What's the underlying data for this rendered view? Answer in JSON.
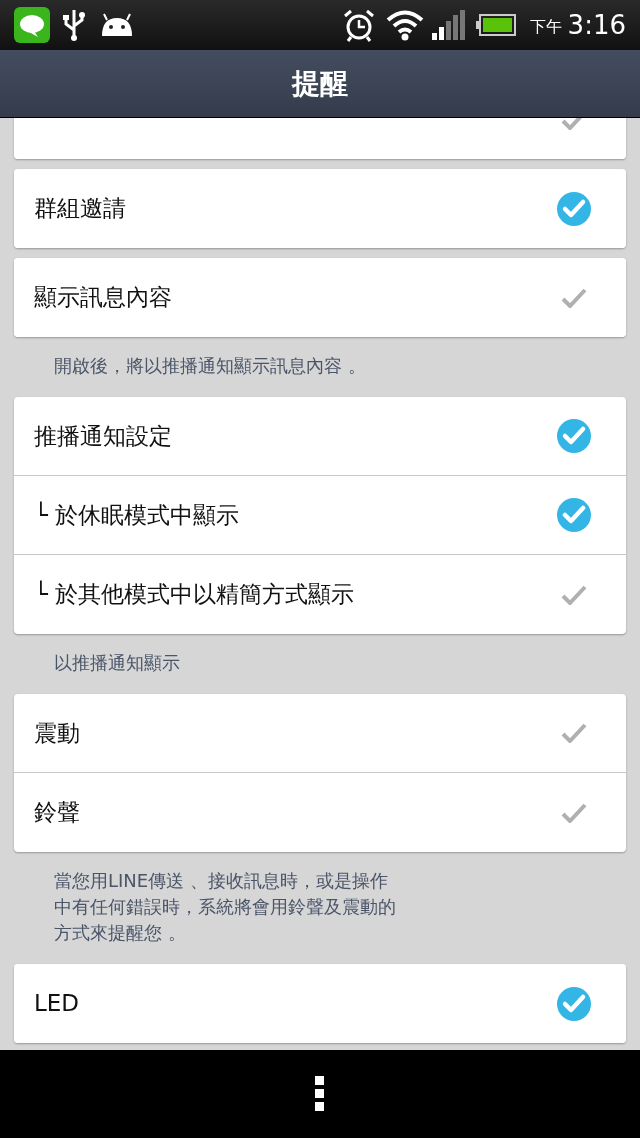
{
  "status_bar": {
    "time_period": "下午",
    "time": "3:16"
  },
  "header": {
    "title": "提醒"
  },
  "sections": [
    {
      "items": [
        {
          "checked": false
        }
      ]
    },
    {
      "items": [
        {
          "label": "群組邀請",
          "checked": true
        }
      ]
    },
    {
      "items": [
        {
          "label": "顯示訊息內容",
          "checked": false
        }
      ],
      "note": "開啟後，將以推播通知顯示訊息內容 。"
    },
    {
      "items": [
        {
          "label": "推播通知設定",
          "checked": true
        },
        {
          "label": "└ 於休眠模式中顯示",
          "checked": true
        },
        {
          "label": "└ 於其他模式中以精簡方式顯示",
          "checked": false
        }
      ],
      "note": "以推播通知顯示"
    },
    {
      "items": [
        {
          "label": "震動",
          "checked": false
        },
        {
          "label": "鈴聲",
          "checked": false
        }
      ],
      "note": "當您用LINE傳送 、接收訊息時，或是操作中有任何錯誤時，系統將會用鈴聲及震動的方式來提醒您 。"
    },
    {
      "items": [
        {
          "label": "LED",
          "checked": true
        }
      ]
    }
  ]
}
